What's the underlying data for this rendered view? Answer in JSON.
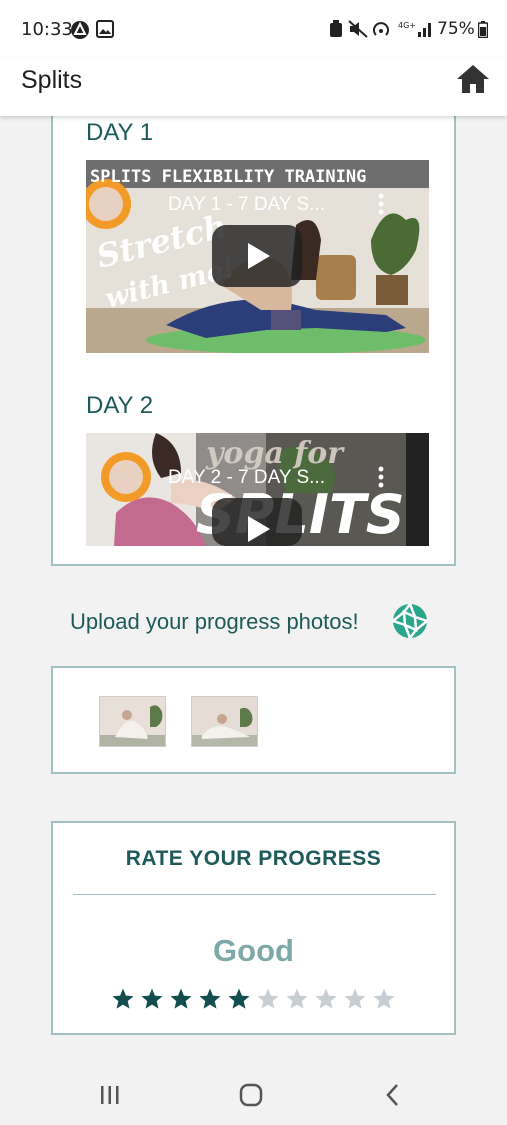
{
  "status_bar": {
    "time": "10:33",
    "battery": "75%",
    "icons": [
      "alert-circle-icon",
      "image-icon",
      "battery-saver-icon",
      "mute-icon",
      "hotspot-icon",
      "signal-4g-icon",
      "battery-icon"
    ]
  },
  "app_bar": {
    "title": "Splits",
    "home_icon": "home-icon"
  },
  "videos": [
    {
      "day_label": "DAY 1",
      "video_title": "DAY 1 - 7 DAY S...",
      "banner_text": "SPLITS FLEXIBILITY TRAINING",
      "overlay_text_1": "Stretch",
      "overlay_text_2": "with me!"
    },
    {
      "day_label": "DAY 2",
      "video_title": "DAY 2 - 7 DAY S...",
      "overlay_text_1": "yoga for",
      "overlay_text_2": "SPLITS"
    }
  ],
  "upload": {
    "text": "Upload your progress photos!",
    "icon": "camera-shutter-icon"
  },
  "photos": {
    "count": 2
  },
  "rating": {
    "title": "RATE YOUR PROGRESS",
    "value_label": "Good",
    "stars_filled": 5,
    "stars_total": 10
  },
  "colors": {
    "accent": "#1e5a5a",
    "card_border": "#9fc1c1",
    "rating_label": "#7fa9a9",
    "star_filled": "#124e4e",
    "star_empty": "#c8cfd2",
    "camera_icon": "#2ba58c"
  },
  "nav_bar": {
    "icons": [
      "recents-icon",
      "home-circle-icon",
      "back-icon"
    ]
  }
}
